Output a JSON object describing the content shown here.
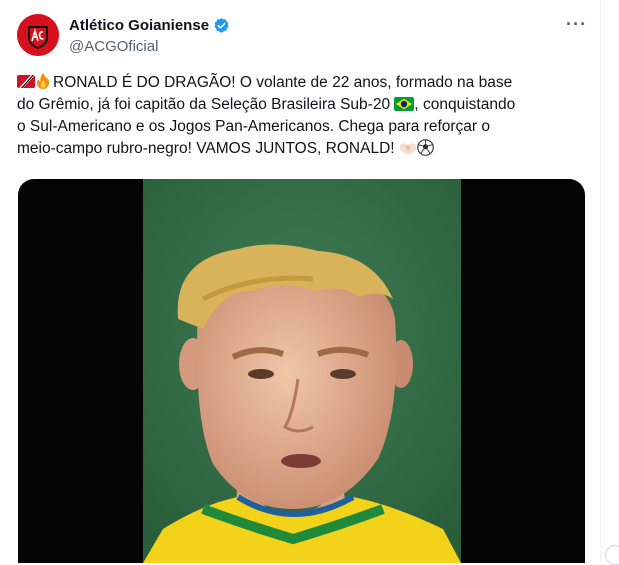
{
  "author": {
    "display_name": "Atlético Goianiense",
    "handle": "@ACGOficial",
    "avatar_icon": "club-crest-icon",
    "verified_icon": "verified-badge-icon"
  },
  "tweet": {
    "line1": "RONALD É DO DRAGÃO! O volante de 22 anos, formado na base",
    "line2": "do Grêmio, já foi capitão da Seleção Brasileira Sub-20",
    "line3": ", conquistando",
    "line4": "o Sul-Americano e os Jogos Pan-Americanos. Chega para reforçar o",
    "line5": "meio-campo rubro-negro! VAMOS JUNTOS, RONALD!"
  },
  "icons": {
    "more": "more-options-icon",
    "flag_tt": "trinidad-flag-emoji",
    "fire": "fire-emoji",
    "flag_br": "brazil-flag-emoji",
    "hands": "handshake-emoji",
    "ball": "soccer-ball-emoji"
  },
  "colors": {
    "accent": "#1d9bf0",
    "avatar_red": "#d6111b",
    "secondary_text": "#536471"
  }
}
